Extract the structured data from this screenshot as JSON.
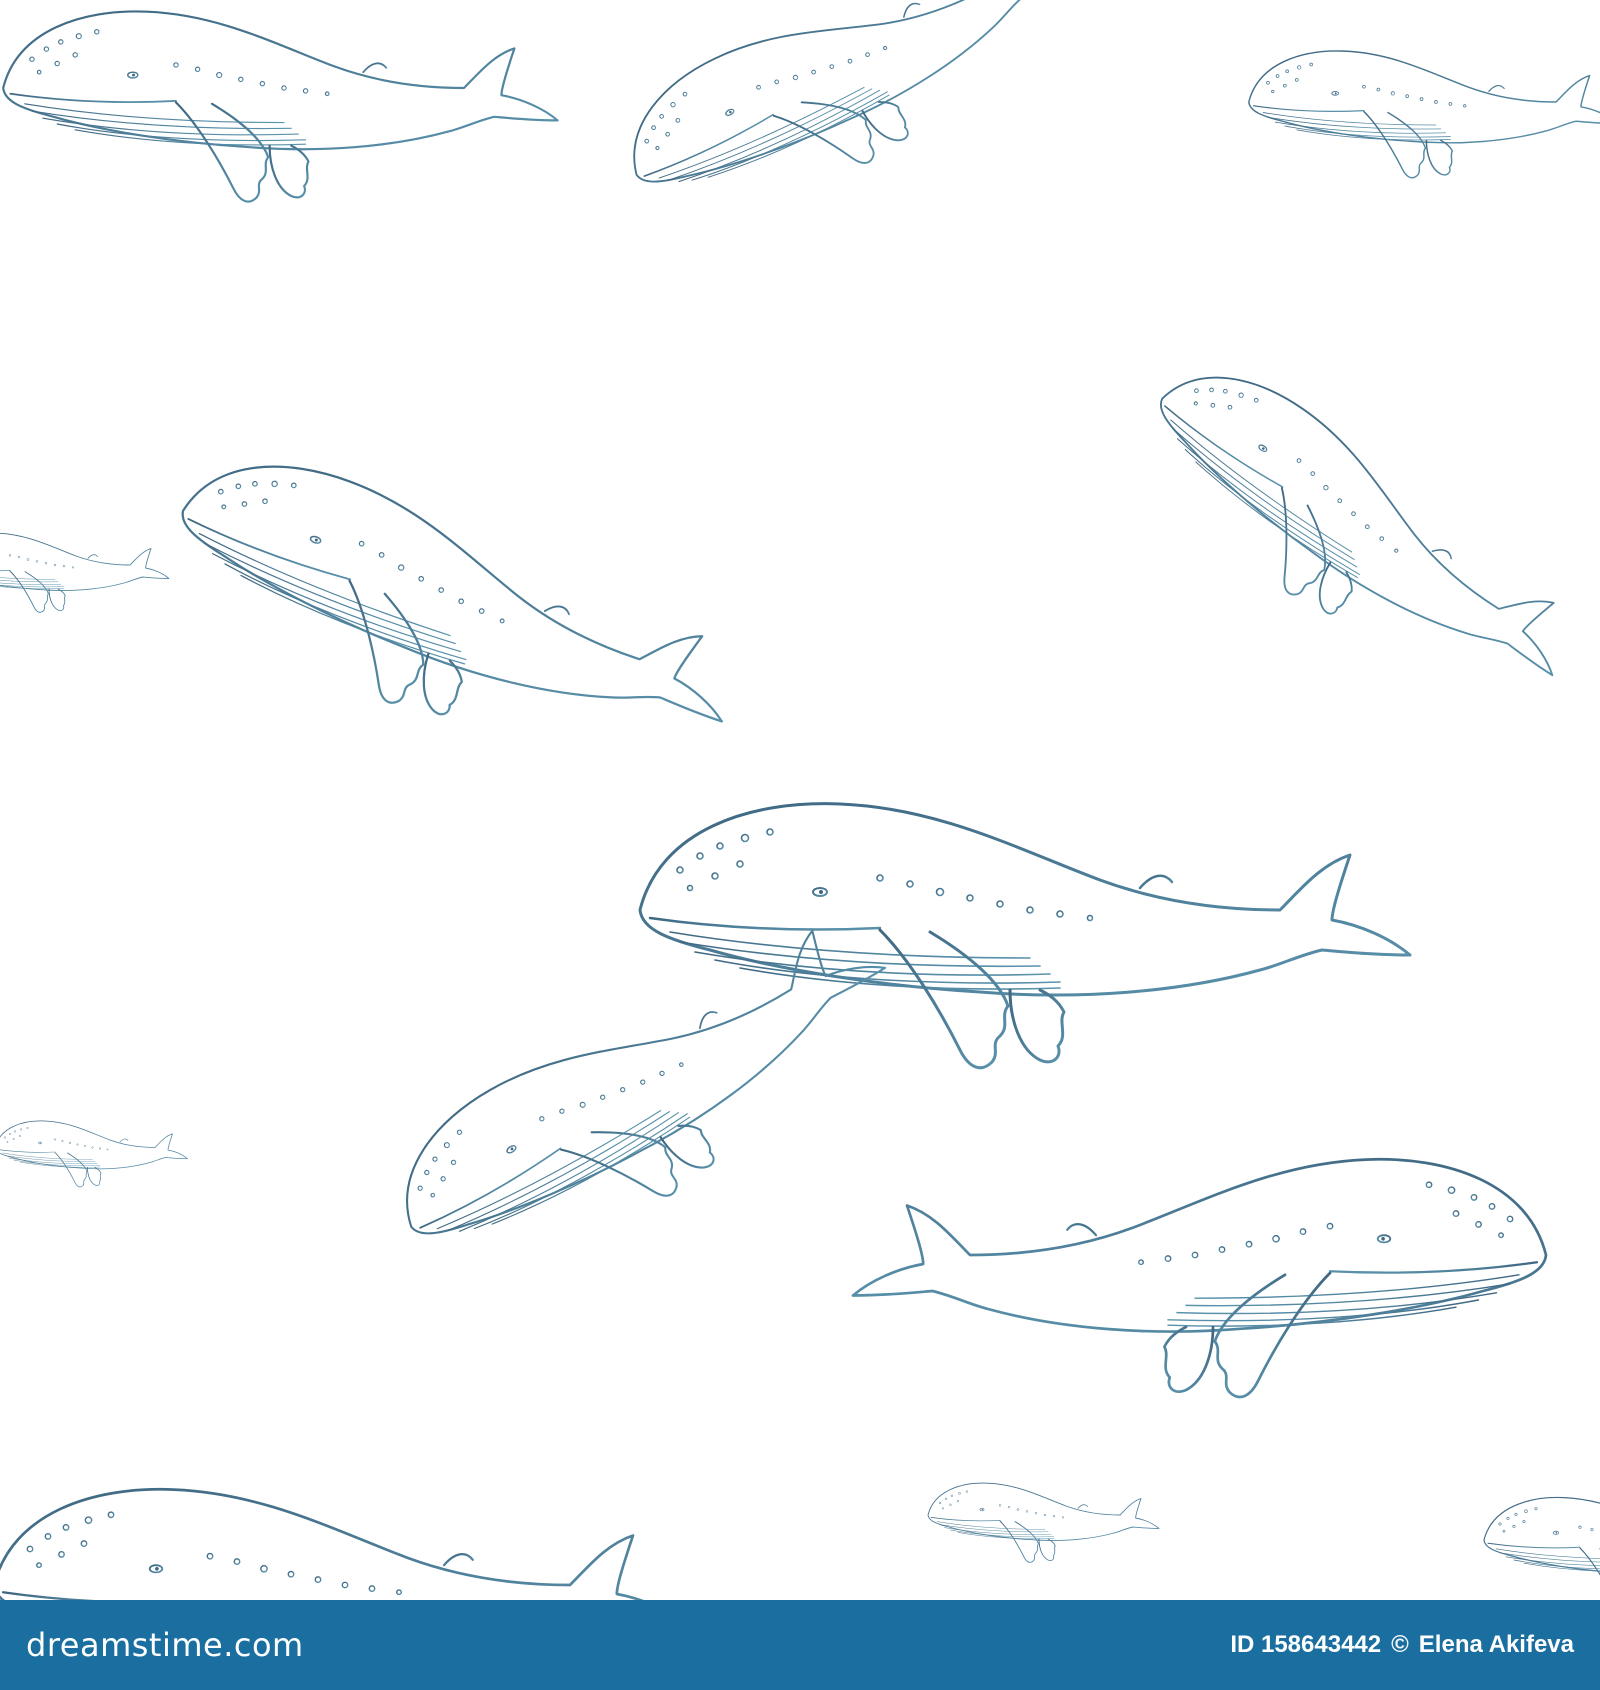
{
  "image": {
    "subject": "Seamless pattern of hand-drawn humpback whales",
    "background_color": "#ffffff",
    "line_colors": [
      "#3f6782",
      "#5a93ad"
    ]
  },
  "footer": {
    "background_color": "#1a6fa0",
    "logo_text": "dreamstime.com",
    "id_text": "ID 158643442",
    "credit_separator": "©",
    "author": "Elena Akifeva"
  }
}
